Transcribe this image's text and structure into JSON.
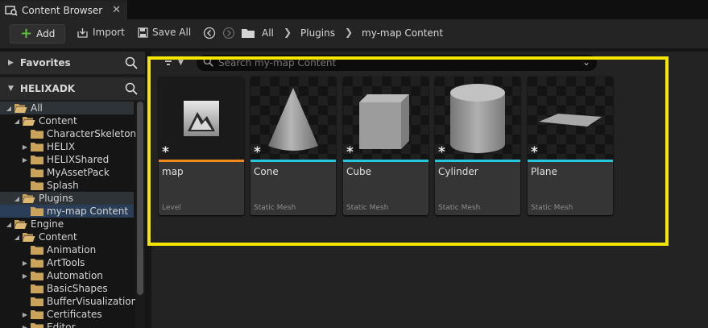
{
  "tab": {
    "title": "Content Browser",
    "close": "✕"
  },
  "toolbar": {
    "add_label": "Add",
    "import_label": "Import",
    "save_all_label": "Save All",
    "breadcrumb": [
      "All",
      "Plugins",
      "my-map Content"
    ]
  },
  "left_panel": {
    "favorites_label": "Favorites",
    "project_label": "HELIXADK",
    "tree": [
      {
        "label": "All",
        "depth": 0,
        "expanded": true,
        "selected": false
      },
      {
        "label": "Content",
        "depth": 1,
        "expanded": true
      },
      {
        "label": "CharacterSkeletons",
        "depth": 2,
        "expanded": false,
        "has_children": false
      },
      {
        "label": "HELIX",
        "depth": 2,
        "has_children": true
      },
      {
        "label": "HELIXShared",
        "depth": 2,
        "has_children": true
      },
      {
        "label": "MyAssetPack",
        "depth": 2,
        "has_children": false
      },
      {
        "label": "Splash",
        "depth": 2,
        "has_children": false
      },
      {
        "label": "Plugins",
        "depth": 1,
        "expanded": true
      },
      {
        "label": "my-map Content",
        "depth": 2,
        "selected": true
      },
      {
        "label": "Engine",
        "depth": 0,
        "expanded": true
      },
      {
        "label": "Content",
        "depth": 1,
        "expanded": true
      },
      {
        "label": "Animation",
        "depth": 2,
        "has_children": false
      },
      {
        "label": "ArtTools",
        "depth": 2,
        "has_children": true
      },
      {
        "label": "Automation",
        "depth": 2,
        "has_children": true
      },
      {
        "label": "BasicShapes",
        "depth": 2,
        "has_children": false
      },
      {
        "label": "BufferVisualization",
        "depth": 2,
        "has_children": false
      },
      {
        "label": "Certificates",
        "depth": 2,
        "has_children": true
      },
      {
        "label": "Editor",
        "depth": 2,
        "has_children": true
      }
    ]
  },
  "search": {
    "placeholder": "Search my-map Content"
  },
  "assets": [
    {
      "name": "map",
      "type": "Level",
      "shape": "level",
      "bar_color": "#f08a1c"
    },
    {
      "name": "Cone",
      "type": "Static Mesh",
      "shape": "cone",
      "bar_color": "#26c6dc"
    },
    {
      "name": "Cube",
      "type": "Static Mesh",
      "shape": "cube",
      "bar_color": "#26c6dc"
    },
    {
      "name": "Cylinder",
      "type": "Static Mesh",
      "shape": "cylinder",
      "bar_color": "#26c6dc"
    },
    {
      "name": "Plane",
      "type": "Static Mesh",
      "shape": "plane",
      "bar_color": "#26c6dc"
    }
  ],
  "colors": {
    "highlight": "#f4e600",
    "selection": "#2b3e57",
    "folder": "#c9a25c"
  }
}
